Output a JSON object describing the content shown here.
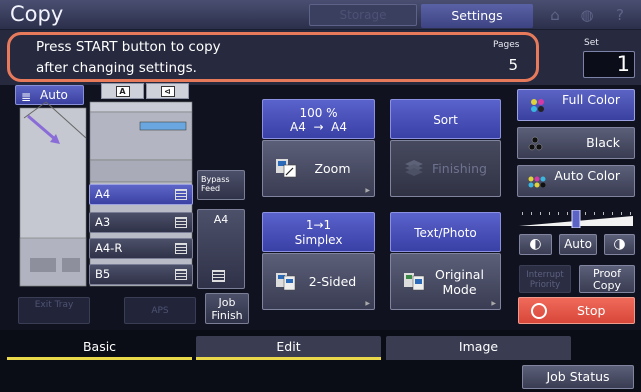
{
  "header": {
    "title": "Copy",
    "dim_tab_left": "Storage",
    "settings_tab": "Settings"
  },
  "message": {
    "line1": "Press START button to copy",
    "line2": "after changing settings."
  },
  "pages": {
    "label": "Pages",
    "value": "5"
  },
  "set": {
    "label": "Set",
    "value": "1"
  },
  "paper": {
    "auto_label": "Auto",
    "trays": [
      "A4",
      "A3",
      "A4-R",
      "B5"
    ],
    "selected_tray": "A4",
    "bypass_label": "Bypass Feed",
    "bypass_size": "A4"
  },
  "bottom_left": {
    "exit_tray": "Exit Tray",
    "aps": "APS",
    "job_finish": "Job Finish"
  },
  "functions": {
    "zoom_value": "100 %",
    "zoom_from": "A4",
    "zoom_arrow": "→",
    "zoom_to": "A4",
    "zoom": "Zoom",
    "sort": "Sort",
    "finishing": "Finishing",
    "simplex_top": "1→1",
    "simplex_bottom": "Simplex",
    "two_sided": "2-Sided",
    "text_photo": "Text/Photo",
    "original_mode": "Original Mode"
  },
  "color": {
    "full_color": "Full Color",
    "black": "Black",
    "auto_color": "Auto Color"
  },
  "density": {
    "auto": "Auto",
    "level_fraction": 0.5
  },
  "actions": {
    "interrupt": "Interrupt Priority",
    "proof_copy": "Proof Copy",
    "stop": "Stop"
  },
  "tabs": [
    "Basic",
    "Edit",
    "Image"
  ],
  "job_status": "Job Status",
  "colors": {
    "accent": "#4a52c4",
    "highlight": "#e87a5c",
    "stop": "#e65a4b",
    "tab_underline": "#e9d84a"
  }
}
